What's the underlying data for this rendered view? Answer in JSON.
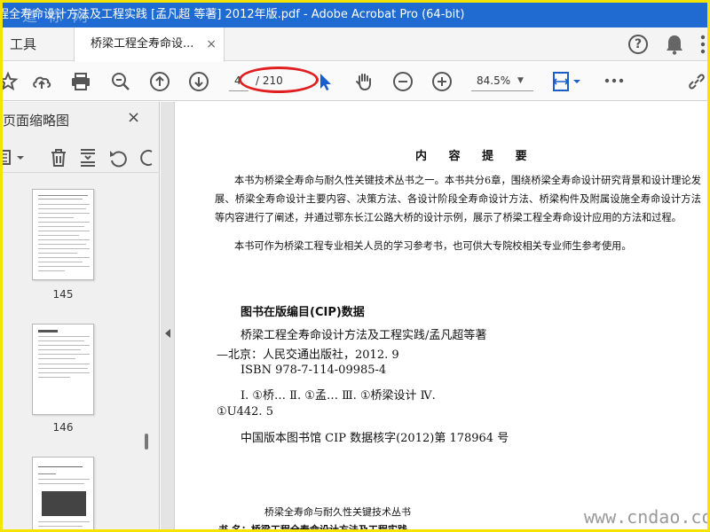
{
  "window": {
    "title": "程全寿命设计方法及工程实践 [孟凡超 等著] 2012年版.pdf - Adobe Acrobat Pro (64-bit)",
    "watermark_top": "道 标 网"
  },
  "tabs": {
    "tools_label": "工具",
    "doc_tab_label": "桥梁工程全寿命设...",
    "close_glyph": "×"
  },
  "toolbar": {
    "current_page": "4",
    "total_pages": "/ 210",
    "zoom": "84.5%"
  },
  "sidepanel": {
    "title": "页面缩略图",
    "close_glyph": "×",
    "thumbnails": [
      {
        "label": "145"
      },
      {
        "label": "146"
      }
    ]
  },
  "document": {
    "intro_heading": "内 容 提 要",
    "intro_p1": "本书为桥梁全寿命与耐久性关键技术丛书之一。本书共分6章，围绕桥梁全寿命设计研究背景和设计理论发展、桥梁全寿命设计主要内容、决策方法、各设计阶段全寿命设计方法、桥梁构件及附属设施全寿命设计方法等内容进行了阐述，并通过鄂东长江公路大桥的设计示例，展示了桥梁工程全寿命设计应用的方法和过程。",
    "intro_p2": "本书可作为桥梁工程专业相关人员的学习参考书，也可供大专院校相关专业师生参考使用。",
    "cip_heading": "图书在版编目(CIP)数据",
    "cip_line1": "桥梁工程全寿命设计方法及工程实践/孟凡超等著",
    "cip_line2": "—北京：人民交通出版社，2012. 9",
    "cip_line3": "ISBN  978-7-114-09985-4",
    "cip_line4": "Ⅰ. ①桥…   Ⅱ. ①孟…   Ⅲ. ①桥梁设计   Ⅳ.",
    "cip_line5": "①U442. 5",
    "cip_line6": "中国版本图书馆 CIP 数据核字(2012)第 178964 号",
    "series_title": "桥梁全寿命与耐久性关键技术丛书",
    "book_name": "书      名：桥梁工程全寿命设计方法及工程实践"
  },
  "watermark_bottom": "www.cndao.com",
  "colors": {
    "titlebar": "#1f6bd1",
    "frame": "#f5e400",
    "annotation_ellipse": "#e02020",
    "cursor": "#1a5fc9"
  }
}
